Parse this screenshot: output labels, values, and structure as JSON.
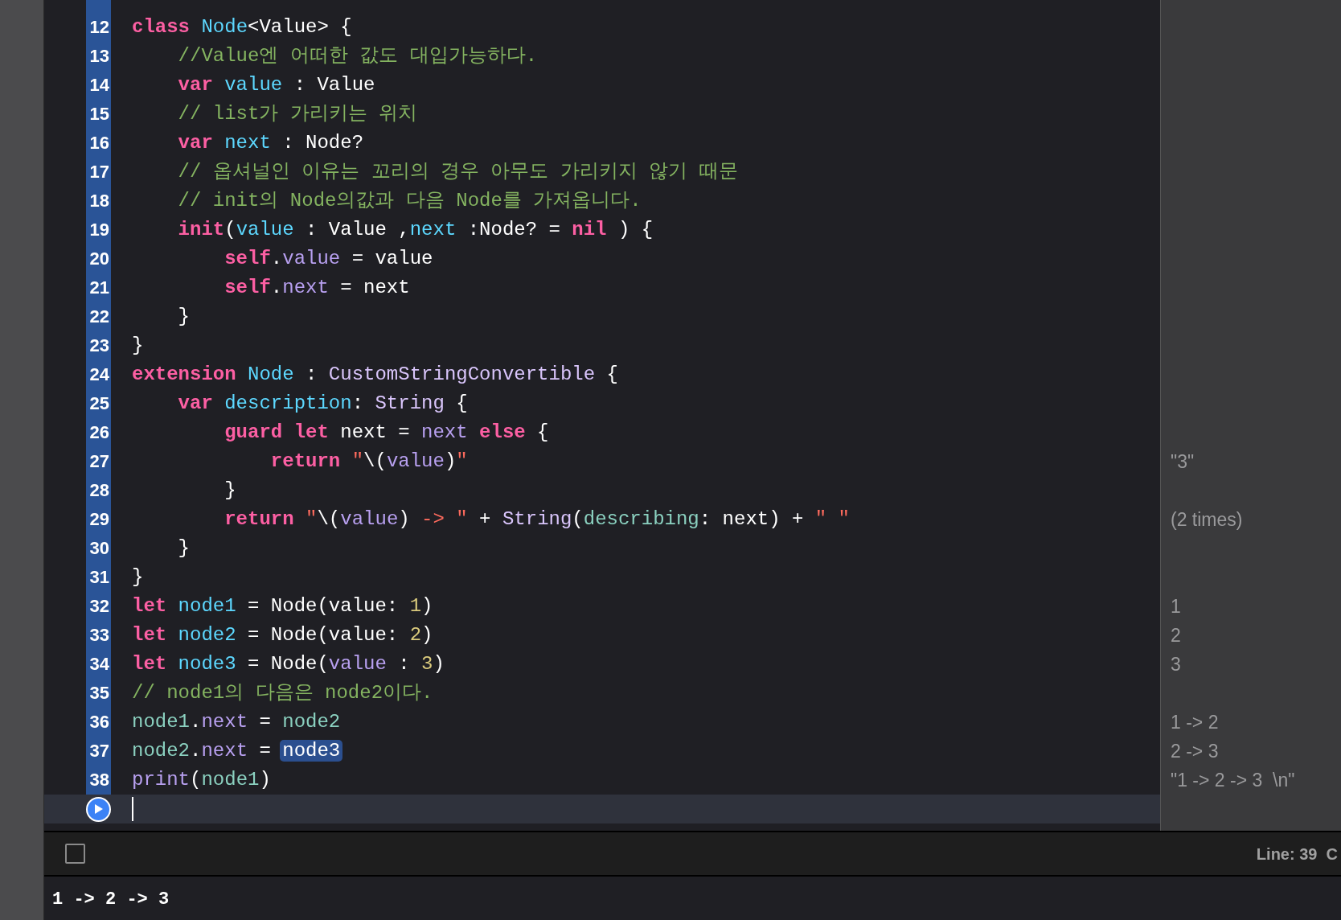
{
  "editor": {
    "lines": [
      {
        "number": "12",
        "tokens": [
          {
            "kind": "keyword",
            "text": "class "
          },
          {
            "kind": "decl",
            "text": "Node"
          },
          {
            "kind": "plain",
            "text": "<Value> {"
          }
        ]
      },
      {
        "number": "13",
        "tokens": [
          {
            "kind": "comment",
            "text": "    //Value엔 어떠한 값도 대입가능하다."
          }
        ]
      },
      {
        "number": "14",
        "tokens": [
          {
            "kind": "keyword",
            "text": "    var "
          },
          {
            "kind": "decl",
            "text": "value"
          },
          {
            "kind": "plain",
            "text": " : Value"
          }
        ]
      },
      {
        "number": "15",
        "tokens": [
          {
            "kind": "comment",
            "text": "    // list가 가리키는 위치"
          }
        ]
      },
      {
        "number": "16",
        "tokens": [
          {
            "kind": "keyword",
            "text": "    var "
          },
          {
            "kind": "decl",
            "text": "next"
          },
          {
            "kind": "plain",
            "text": " : Node?"
          }
        ]
      },
      {
        "number": "17",
        "tokens": [
          {
            "kind": "comment",
            "text": "    // 옵셔널인 이유는 꼬리의 경우 아무도 가리키지 않기 때문"
          }
        ]
      },
      {
        "number": "18",
        "tokens": [
          {
            "kind": "comment",
            "text": "    // init의 Node의값과 다음 Node를 가져옵니다."
          }
        ]
      },
      {
        "number": "19",
        "tokens": [
          {
            "kind": "keyword",
            "text": "    init"
          },
          {
            "kind": "plain",
            "text": "("
          },
          {
            "kind": "decl",
            "text": "value"
          },
          {
            "kind": "plain",
            "text": " : Value ,"
          },
          {
            "kind": "decl",
            "text": "next"
          },
          {
            "kind": "plain",
            "text": " :Node? = "
          },
          {
            "kind": "keyword",
            "text": "nil"
          },
          {
            "kind": "plain",
            "text": " ) {"
          }
        ]
      },
      {
        "number": "20",
        "tokens": [
          {
            "kind": "keyword",
            "text": "        self"
          },
          {
            "kind": "plain",
            "text": "."
          },
          {
            "kind": "member",
            "text": "value"
          },
          {
            "kind": "plain",
            "text": " = value"
          }
        ]
      },
      {
        "number": "21",
        "tokens": [
          {
            "kind": "keyword",
            "text": "        self"
          },
          {
            "kind": "plain",
            "text": "."
          },
          {
            "kind": "member",
            "text": "next"
          },
          {
            "kind": "plain",
            "text": " = next"
          }
        ]
      },
      {
        "number": "22",
        "tokens": [
          {
            "kind": "plain",
            "text": "    }"
          }
        ]
      },
      {
        "number": "23",
        "tokens": [
          {
            "kind": "plain",
            "text": "}"
          }
        ]
      },
      {
        "number": "24",
        "tokens": [
          {
            "kind": "keyword",
            "text": "extension "
          },
          {
            "kind": "decl",
            "text": "Node"
          },
          {
            "kind": "plain",
            "text": " : "
          },
          {
            "kind": "type",
            "text": "CustomStringConvertible"
          },
          {
            "kind": "plain",
            "text": " {"
          }
        ]
      },
      {
        "number": "25",
        "tokens": [
          {
            "kind": "keyword",
            "text": "    var "
          },
          {
            "kind": "decl",
            "text": "description"
          },
          {
            "kind": "plain",
            "text": ": "
          },
          {
            "kind": "type",
            "text": "String"
          },
          {
            "kind": "plain",
            "text": " {"
          }
        ]
      },
      {
        "number": "26",
        "tokens": [
          {
            "kind": "keyword",
            "text": "        guard let"
          },
          {
            "kind": "plain",
            "text": " next = "
          },
          {
            "kind": "member",
            "text": "next"
          },
          {
            "kind": "keyword",
            "text": " else"
          },
          {
            "kind": "plain",
            "text": " {"
          }
        ]
      },
      {
        "number": "27",
        "result": "\"3\"",
        "tokens": [
          {
            "kind": "keyword",
            "text": "            return "
          },
          {
            "kind": "string",
            "text": "\""
          },
          {
            "kind": "plain",
            "text": "\\("
          },
          {
            "kind": "member",
            "text": "value"
          },
          {
            "kind": "plain",
            "text": ")"
          },
          {
            "kind": "string",
            "text": "\""
          }
        ]
      },
      {
        "number": "28",
        "tokens": [
          {
            "kind": "plain",
            "text": "        }"
          }
        ]
      },
      {
        "number": "29",
        "result": "(2 times)",
        "tokens": [
          {
            "kind": "keyword",
            "text": "        return "
          },
          {
            "kind": "string",
            "text": "\""
          },
          {
            "kind": "plain",
            "text": "\\("
          },
          {
            "kind": "member",
            "text": "value"
          },
          {
            "kind": "plain",
            "text": ")"
          },
          {
            "kind": "string",
            "text": " -> \""
          },
          {
            "kind": "plain",
            "text": " + "
          },
          {
            "kind": "type",
            "text": "String"
          },
          {
            "kind": "plain",
            "text": "("
          },
          {
            "kind": "local",
            "text": "describing"
          },
          {
            "kind": "plain",
            "text": ": next) + "
          },
          {
            "kind": "string",
            "text": "\" \""
          }
        ]
      },
      {
        "number": "30",
        "tokens": [
          {
            "kind": "plain",
            "text": "    }"
          }
        ]
      },
      {
        "number": "31",
        "tokens": [
          {
            "kind": "plain",
            "text": "}"
          }
        ]
      },
      {
        "number": "32",
        "result": "1",
        "tokens": [
          {
            "kind": "keyword",
            "text": "let "
          },
          {
            "kind": "decl",
            "text": "node1"
          },
          {
            "kind": "plain",
            "text": " = Node(value: "
          },
          {
            "kind": "number",
            "text": "1"
          },
          {
            "kind": "plain",
            "text": ")"
          }
        ]
      },
      {
        "number": "33",
        "result": "2",
        "tokens": [
          {
            "kind": "keyword",
            "text": "let "
          },
          {
            "kind": "decl",
            "text": "node2"
          },
          {
            "kind": "plain",
            "text": " = Node(value: "
          },
          {
            "kind": "number",
            "text": "2"
          },
          {
            "kind": "plain",
            "text": ")"
          }
        ]
      },
      {
        "number": "34",
        "result": "3",
        "tokens": [
          {
            "kind": "keyword",
            "text": "let "
          },
          {
            "kind": "decl",
            "text": "node3"
          },
          {
            "kind": "plain",
            "text": " = Node("
          },
          {
            "kind": "member",
            "text": "value"
          },
          {
            "kind": "plain",
            "text": " : "
          },
          {
            "kind": "number",
            "text": "3"
          },
          {
            "kind": "plain",
            "text": ")"
          }
        ]
      },
      {
        "number": "35",
        "tokens": [
          {
            "kind": "comment",
            "text": "// node1의 다음은 node2이다."
          }
        ]
      },
      {
        "number": "36",
        "result": "1 -> 2",
        "tokens": [
          {
            "kind": "local",
            "text": "node1"
          },
          {
            "kind": "plain",
            "text": "."
          },
          {
            "kind": "member",
            "text": "next"
          },
          {
            "kind": "plain",
            "text": " = "
          },
          {
            "kind": "local",
            "text": "node2"
          }
        ]
      },
      {
        "number": "37",
        "result": "2 -> 3",
        "tokens": [
          {
            "kind": "local",
            "text": "node2"
          },
          {
            "kind": "plain",
            "text": "."
          },
          {
            "kind": "member",
            "text": "next"
          },
          {
            "kind": "plain",
            "text": " = "
          },
          {
            "kind": "selection",
            "text": "node3"
          }
        ]
      },
      {
        "number": "38",
        "result": "\"1 -> 2 -> 3  \\n\"",
        "tokens": [
          {
            "kind": "member",
            "text": "print"
          },
          {
            "kind": "plain",
            "text": "("
          },
          {
            "kind": "local",
            "text": "node1"
          },
          {
            "kind": "plain",
            "text": ")"
          }
        ]
      }
    ]
  },
  "status_bar": {
    "cursor_position": "Line: 39  C"
  },
  "console": {
    "output": "1 -> 2 -> 3"
  }
}
